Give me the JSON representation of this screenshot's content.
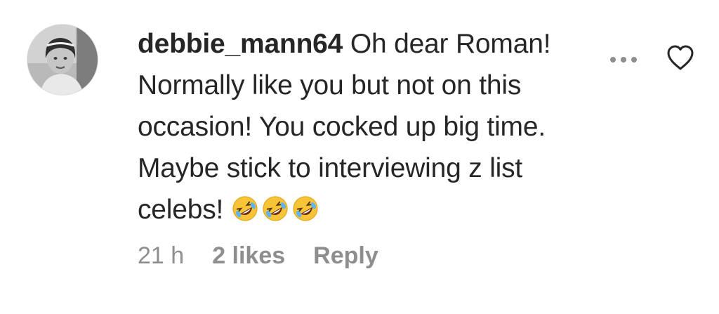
{
  "comment": {
    "username": "debbie_mann64",
    "text_lines": [
      "Oh dear Roman!",
      "Normally like you but not on this",
      "occasion! You cocked up big time.",
      "Maybe stick to interviewing z list",
      "celebs!"
    ],
    "emojis": [
      "rolling-on-floor-laughing-emoji",
      "rolling-on-floor-laughing-emoji",
      "rolling-on-floor-laughing-emoji"
    ],
    "timestamp": "21 h",
    "likes": "2 likes",
    "reply_label": "Reply",
    "more_icon": "more-options-icon",
    "like_icon": "heart-outline-icon"
  }
}
